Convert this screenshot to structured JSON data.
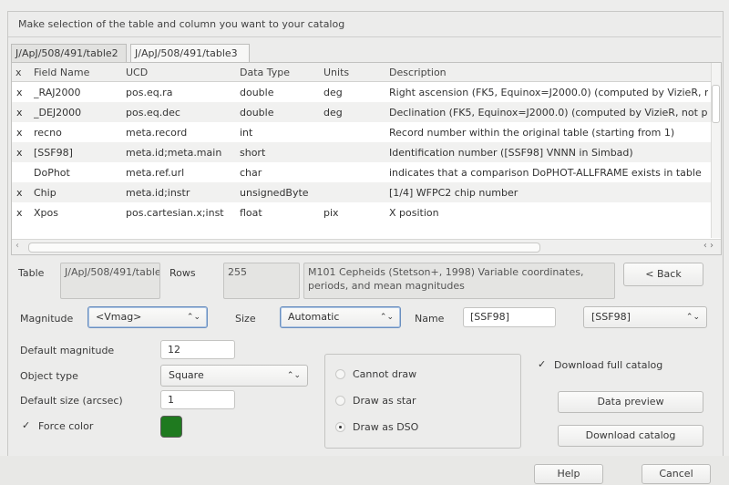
{
  "instruction": "Make selection of the table and column you want to your catalog",
  "tabs": [
    {
      "label": "J/ApJ/508/491/table2"
    },
    {
      "label": "J/ApJ/508/491/table3"
    }
  ],
  "columns": {
    "x": "x",
    "field": "Field Name",
    "ucd": "UCD",
    "type": "Data Type",
    "units": "Units",
    "desc": "Description"
  },
  "rows": [
    {
      "x": "x",
      "field": "_RAJ2000",
      "ucd": "pos.eq.ra",
      "type": "double",
      "units": "deg",
      "desc": "Right ascension (FK5, Equinox=J2000.0) (computed by VizieR, n"
    },
    {
      "x": "x",
      "field": "_DEJ2000",
      "ucd": "pos.eq.dec",
      "type": "double",
      "units": "deg",
      "desc": "Declination (FK5, Equinox=J2000.0) (computed by VizieR, not p"
    },
    {
      "x": "x",
      "field": "recno",
      "ucd": "meta.record",
      "type": "int",
      "units": "",
      "desc": "Record number within the original table (starting from 1)"
    },
    {
      "x": "x",
      "field": "[SSF98]",
      "ucd": "meta.id;meta.main",
      "type": "short",
      "units": "",
      "desc": "Identification number ([SSF98] VNNN in Simbad)"
    },
    {
      "x": "",
      "field": "DoPhot",
      "ucd": "meta.ref.url",
      "type": "char",
      "units": "",
      "desc": "indicates that a comparison DoPHOT-ALLFRAME exists in table"
    },
    {
      "x": "x",
      "field": "Chip",
      "ucd": "meta.id;instr",
      "type": "unsignedByte",
      "units": "",
      "desc": "[1/4] WFPC2 chip number"
    },
    {
      "x": "x",
      "field": "Xpos",
      "ucd": "pos.cartesian.x;inst",
      "type": "float",
      "units": "pix",
      "desc": "X position"
    }
  ],
  "info": {
    "table_label": "Table",
    "table_value": "J/ApJ/508/491/table3",
    "rows_label": "Rows",
    "rows_value": "255",
    "description": "M101 Cepheids (Stetson+, 1998) Variable coordinates, periods, and mean magnitudes"
  },
  "back_label": "< Back",
  "magnitude": {
    "label": "Magnitude",
    "value": "<Vmag>"
  },
  "size": {
    "label": "Size",
    "value": "Automatic"
  },
  "name": {
    "label": "Name",
    "value": "[SSF98]",
    "select_value": "[SSF98]"
  },
  "default_magnitude": {
    "label": "Default magnitude",
    "value": "12"
  },
  "object_type": {
    "label": "Object type",
    "value": "Square"
  },
  "default_size": {
    "label": "Default size (arcsec)",
    "value": "1"
  },
  "force_color": {
    "label": "Force color",
    "checked": true,
    "color": "#1f7a1f"
  },
  "draw_options": [
    {
      "label": "Cannot draw",
      "selected": false
    },
    {
      "label": "Draw as star",
      "selected": false
    },
    {
      "label": "Draw as DSO",
      "selected": true
    }
  ],
  "download_full": {
    "label": "Download full catalog",
    "checked": true
  },
  "data_preview_label": "Data preview",
  "download_catalog_label": "Download catalog",
  "help_label": "Help",
  "cancel_label": "Cancel",
  "symbols": {
    "check": "✓",
    "chevrons": "⌃⌄",
    "left_arrow": "‹",
    "right_arrows": "‹ ›"
  }
}
